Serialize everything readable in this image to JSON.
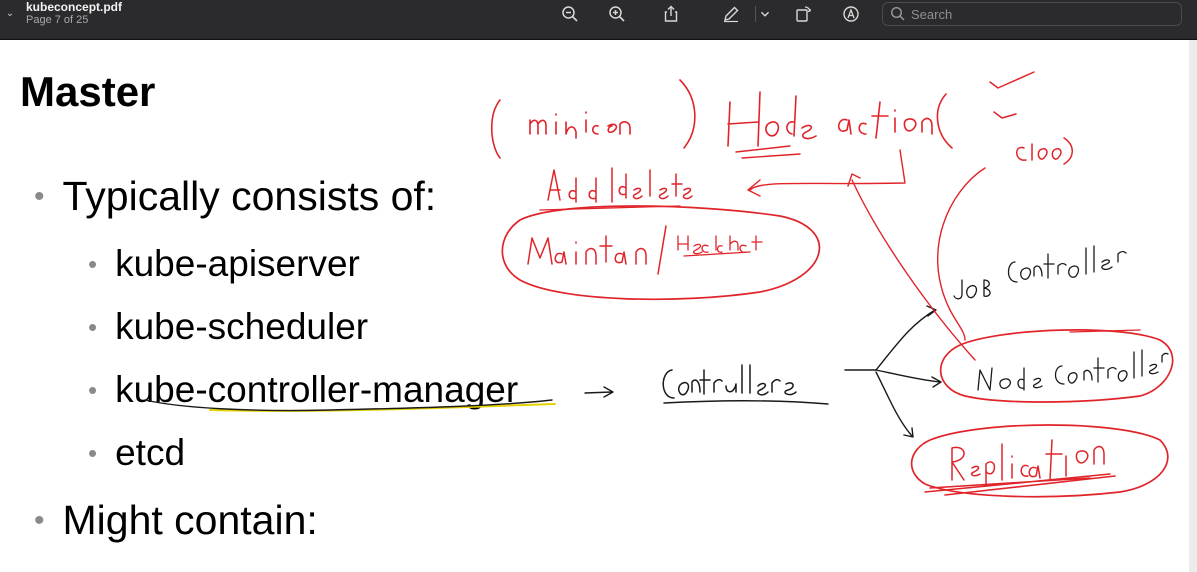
{
  "toolbar": {
    "document_title": "kubeconcept.pdf",
    "page_indicator": "Page 7 of 25",
    "search_placeholder": "Search"
  },
  "slide": {
    "title": "Master",
    "bullets": [
      {
        "level": 1,
        "text": "Typically consists of:"
      },
      {
        "level": 2,
        "text": "kube-apiserver"
      },
      {
        "level": 2,
        "text": "kube-scheduler"
      },
      {
        "level": 2,
        "text": "kube-controller-manager"
      },
      {
        "level": 2,
        "text": "etcd"
      },
      {
        "level": 1,
        "text": "Might contain:"
      }
    ]
  },
  "annotations": {
    "ink_red": "#e0242a",
    "ink_black": "#1a1a1a",
    "ink_yellow": "#e6d200",
    "handwriting": {
      "minion": "minion",
      "node_action": "Node action",
      "cloud": "cloud",
      "add_delete": "Add/delete",
      "maintain": "Maintain / healthcheck",
      "job_controller": "Job Controller",
      "controllers": "Controllers",
      "node_controller": "Node Controller",
      "replication": "Replication"
    }
  }
}
